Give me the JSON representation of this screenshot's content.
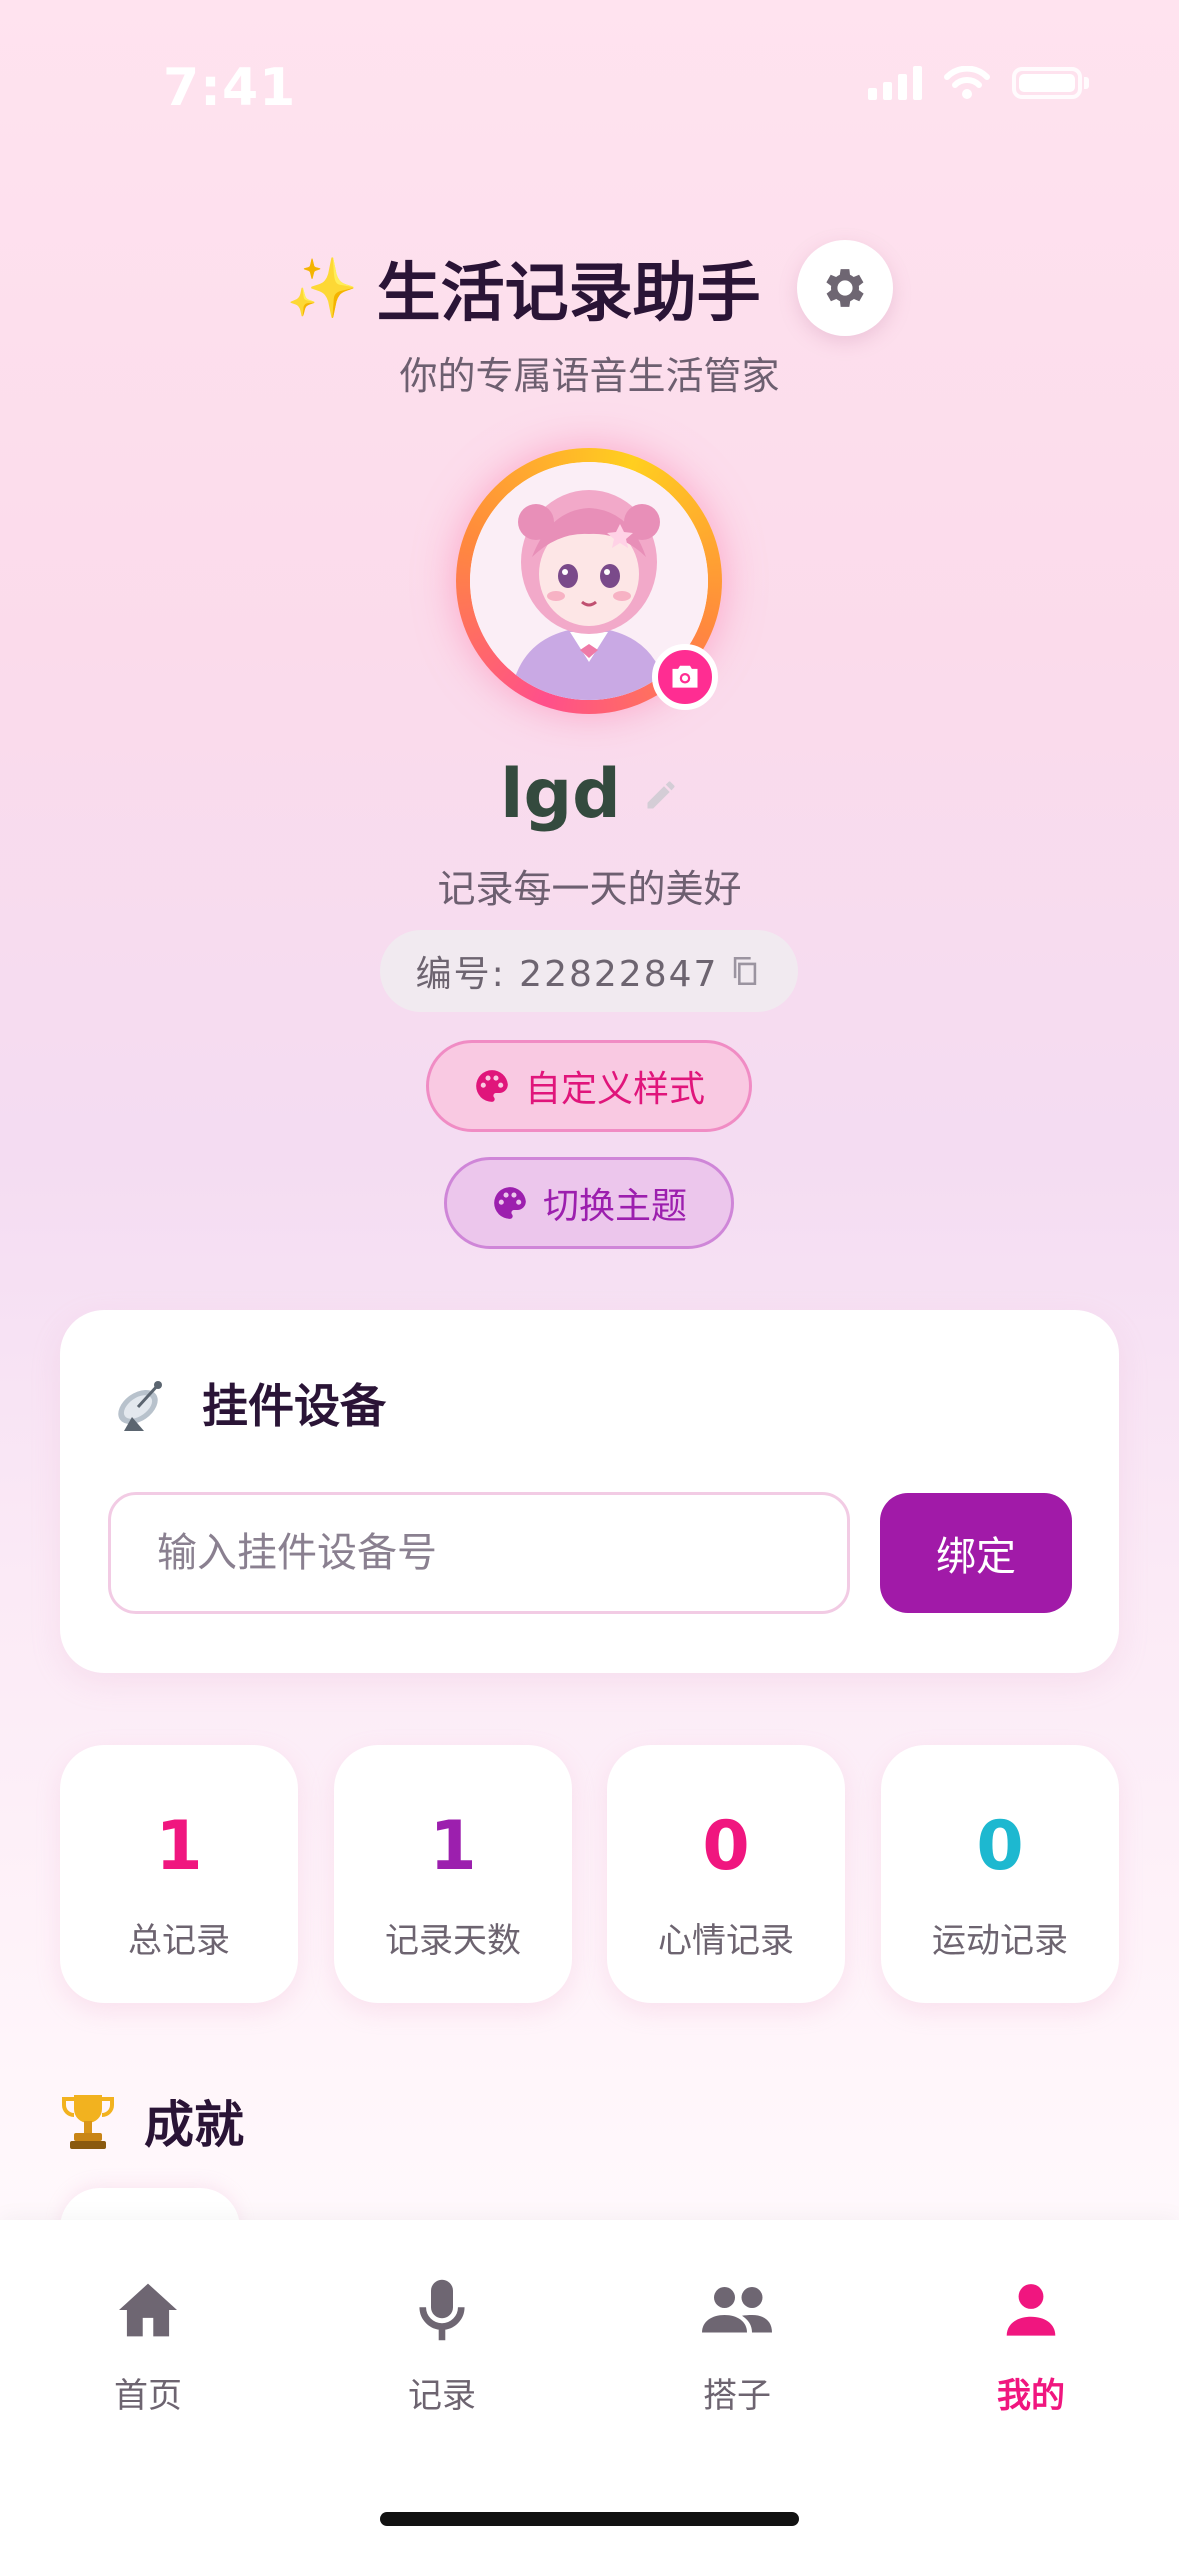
{
  "status_bar": {
    "time": "7:41"
  },
  "header": {
    "title": "生活记录助手",
    "sparkle_icon": "sparkles",
    "subtitle": "你的专属语音生活管家"
  },
  "profile": {
    "username": "lgd",
    "motto": "记录每一天的美好",
    "id_label": "编号: 22822847",
    "custom_style_label": "自定义样式",
    "switch_theme_label": "切换主题"
  },
  "device": {
    "title": "挂件设备",
    "input_value": "",
    "input_placeholder": "输入挂件设备号",
    "bind_label": "绑定"
  },
  "stats": [
    {
      "value": "1",
      "label": "总记录",
      "color": "#f0167f"
    },
    {
      "value": "1",
      "label": "记录天数",
      "color": "#9c1fae"
    },
    {
      "value": "0",
      "label": "心情记录",
      "color": "#f0167f"
    },
    {
      "value": "0",
      "label": "运动记录",
      "color": "#1db8d0"
    }
  ],
  "achievements": {
    "title": "成就"
  },
  "tabs": [
    {
      "label": "首页",
      "icon": "home-icon"
    },
    {
      "label": "记录",
      "icon": "mic-icon"
    },
    {
      "label": "搭子",
      "icon": "people-icon"
    },
    {
      "label": "我的",
      "icon": "person-icon",
      "active": true
    }
  ],
  "colors": {
    "accent": "#f0167f",
    "purple": "#a11aa8"
  }
}
